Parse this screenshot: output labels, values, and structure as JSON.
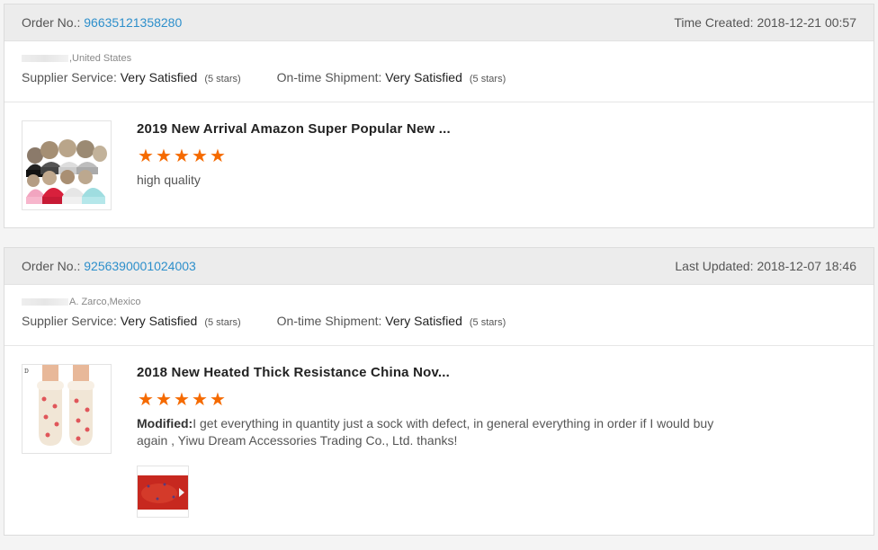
{
  "orders": [
    {
      "order_label": "Order No.:",
      "order_number": "96635121358280",
      "time_label": "Time Created:",
      "time_value": "2018-12-21 00:57",
      "buyer_location": ",United States",
      "supplier_label": "Supplier Service:",
      "supplier_value": "Very Satisfied",
      "supplier_stars": "(5 stars)",
      "shipment_label": "On-time Shipment:",
      "shipment_value": "Very Satisfied",
      "shipment_stars": "(5 stars)",
      "product_title": "2019 New Arrival Amazon Super Popular New ...",
      "rating": 5,
      "review_text": "high quality",
      "thumbnail_icon": "knit-hats-image"
    },
    {
      "order_label": "Order No.:",
      "order_number": "9256390001024003",
      "time_label": "Last Updated:",
      "time_value": "2018-12-07 18:46",
      "buyer_location": "A. Zarco,Mexico",
      "supplier_label": "Supplier Service:",
      "supplier_value": "Very Satisfied",
      "supplier_stars": "(5 stars)",
      "shipment_label": "On-time Shipment:",
      "shipment_value": "Very Satisfied",
      "shipment_stars": "(5 stars)",
      "product_title": "2018 New Heated Thick Resistance China Nov...",
      "rating": 5,
      "review_label": "Modified:",
      "review_text": "I get everything in quantity just a sock with defect, in general everything in order if I would buy again , Yiwu Dream Accessories Trading Co., Ltd. thanks!",
      "thumbnail_icon": "heart-socks-image",
      "review_photo_icon": "red-sock-photo"
    }
  ],
  "colors": {
    "link": "#2d8fcb",
    "star": "#f56a00",
    "header_bg": "#ececec"
  }
}
